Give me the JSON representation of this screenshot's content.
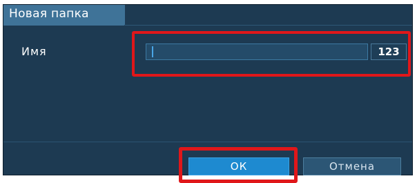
{
  "dialog": {
    "title": "Новая папка",
    "field_label": "Имя",
    "name_input": {
      "value": "",
      "side_value": "123"
    },
    "buttons": {
      "ok_label": "ОК",
      "cancel_label": "Отмена"
    }
  },
  "colors": {
    "dialog_bg": "#1d3a52",
    "title_bg": "#3f7398",
    "accent_button": "#1e8ad0",
    "highlight_frame": "#e0171a"
  }
}
